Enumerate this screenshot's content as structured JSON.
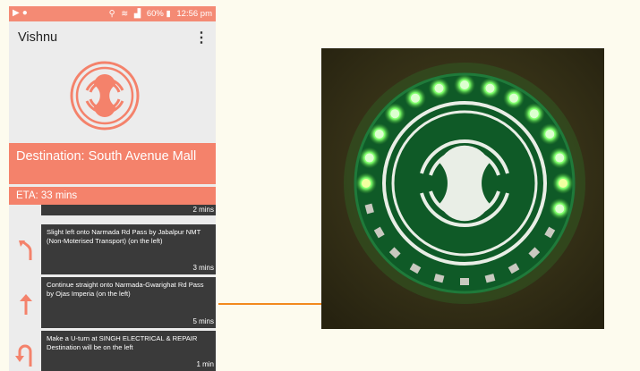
{
  "status_bar": {
    "battery": "60%",
    "time": "12:56 pm",
    "icons": [
      "play-icon",
      "chat-icon",
      "location-icon",
      "wifi-icon",
      "signal-icon",
      "battery-icon"
    ]
  },
  "app_bar": {
    "title": "Vishnu",
    "menu_icon": "more-vert-icon"
  },
  "destination": "Destination: South Avenue Mall",
  "eta": "ETA: 33 mins",
  "previous_step_duration": "2 mins",
  "steps": [
    {
      "icon": "slight-left-arrow-icon",
      "text": "Slight left onto Narmada Rd Pass by Jabalpur NMT (Non-Moterised Transport) (on the left)",
      "duration": "3 mins"
    },
    {
      "icon": "straight-arrow-icon",
      "text": "Continue straight onto Narmada-Gwarighat Rd Pass by Ojas Imperia (on the left)",
      "duration": "5 mins"
    },
    {
      "icon": "u-turn-arrow-icon",
      "text": "Make a U-turn at SINGH ELECTRICAL & REPAIR Destination will be on the left",
      "duration": "1 min"
    }
  ],
  "colors": {
    "accent": "#f4826b",
    "card": "#3a3a3a",
    "led_green": "#7dff6a",
    "led_yellow": "#f2ffa0",
    "connector": "#f28a1e"
  }
}
